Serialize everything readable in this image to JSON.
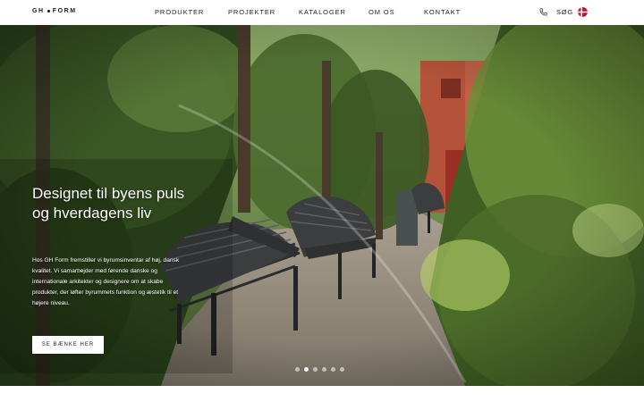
{
  "header": {
    "logo_left": "GH",
    "logo_right": "FORM",
    "nav": [
      {
        "label": "PRODUKTER"
      },
      {
        "label": "PROJEKTER"
      },
      {
        "label": "KATALOGER"
      },
      {
        "label": "OM OS"
      },
      {
        "label": "KONTAKT"
      }
    ],
    "search_label": "SØG",
    "phone_icon": "phone-icon",
    "language_icon": "danish-flag-icon"
  },
  "hero": {
    "title": "Designet til byens puls og hverdagens liv",
    "body": "Hos GH Form fremstiller vi byrumsinventar af høj, dansk kvalitet. Vi samarbejder med førende danske og internationale arkitekter og designere om at skabe produkter, der løfter byrummets funktion og æstetik til et højere niveau.",
    "cta_label": "SE BÆNKE HER",
    "slides_count": 6,
    "active_slide": 2
  },
  "colors": {
    "accent_flag_red": "#c8102e",
    "foliage": "#3f5a27",
    "brick": "#b5533a"
  }
}
